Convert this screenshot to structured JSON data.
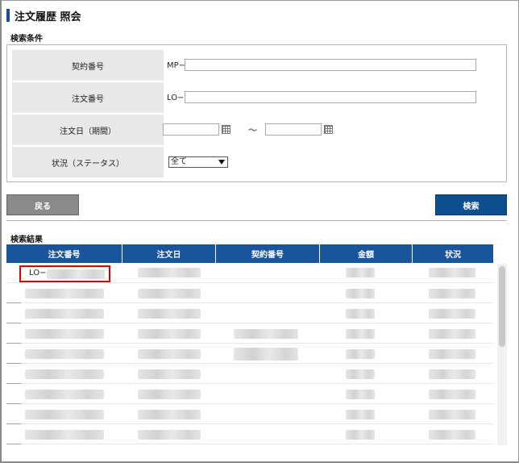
{
  "page_title": "注文履歴 照会",
  "search_conditions": {
    "heading": "検索条件",
    "contract_number": {
      "label": "契約番号",
      "prefix": "MP−",
      "value": ""
    },
    "order_number": {
      "label": "注文番号",
      "prefix": "LO−",
      "value": ""
    },
    "order_date": {
      "label": "注文日（期間）",
      "from": "",
      "separator": "〜",
      "to": ""
    },
    "status": {
      "label": "状況（ステータス）",
      "selected": "全て"
    }
  },
  "buttons": {
    "back": "戻る",
    "search": "検索"
  },
  "results": {
    "heading": "検索結果",
    "columns": [
      "注文番号",
      "注文日",
      "契約番号",
      "金額",
      "状況"
    ],
    "first_row_order_prefix": "LO−"
  },
  "icons": {
    "calendar": "calendar-icon",
    "dropdown": "chevron-down-icon"
  },
  "colors": {
    "header_blue": "#1a549c",
    "search_button": "#0d4f8f",
    "back_button": "#8a8a8a",
    "highlight": "#e00000"
  }
}
